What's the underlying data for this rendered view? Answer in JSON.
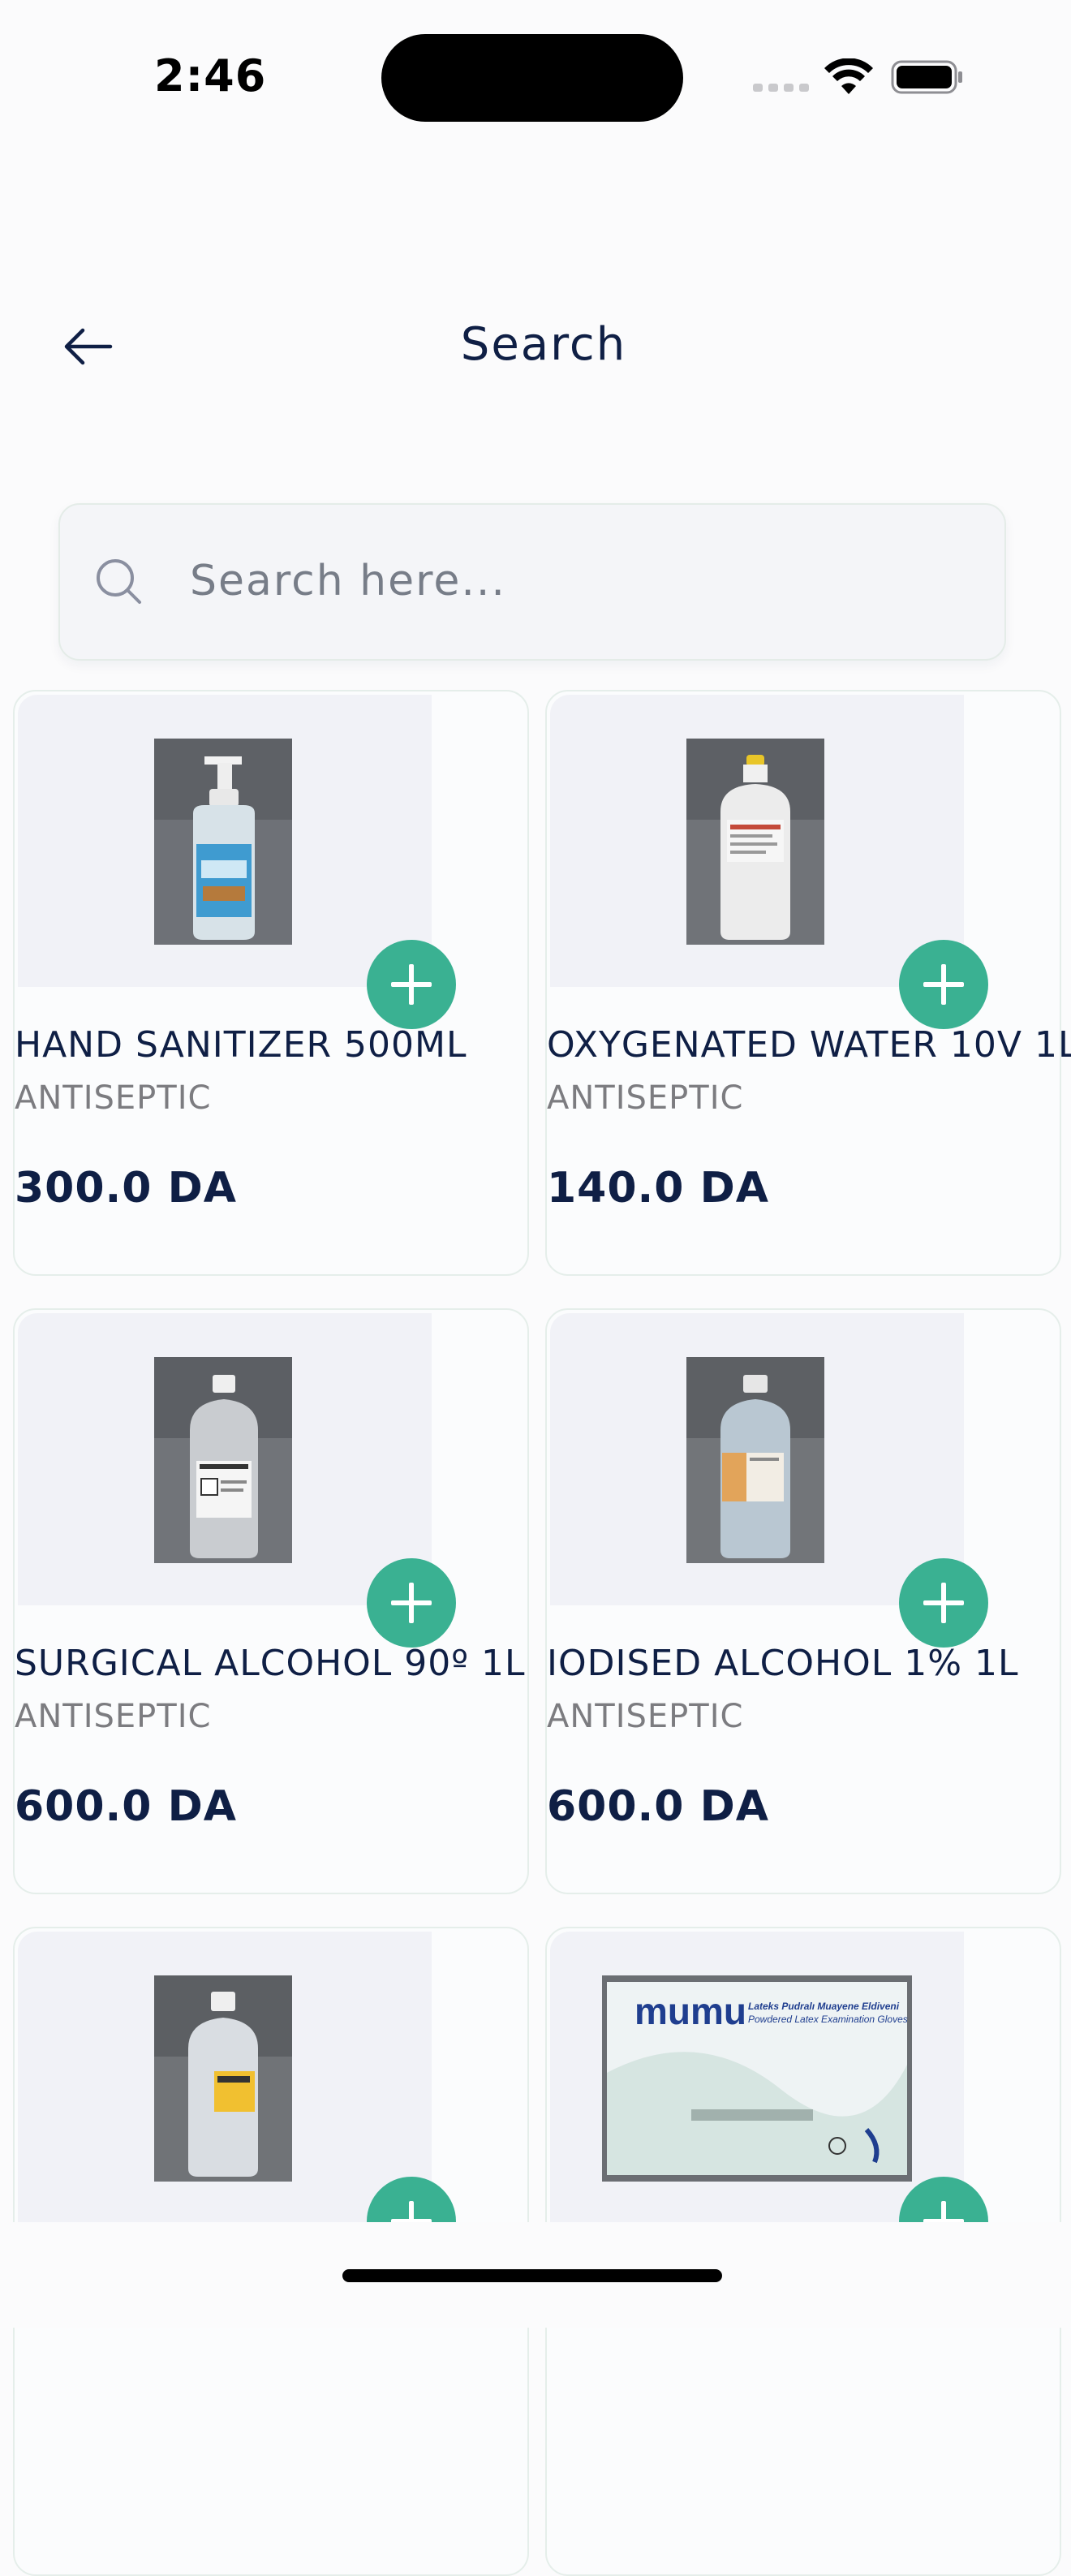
{
  "status_bar": {
    "time": "2:46"
  },
  "header": {
    "title": "Search"
  },
  "search": {
    "placeholder": "Search here..."
  },
  "products": [
    {
      "name": "HAND SANITIZER 500ML",
      "category": "ANTISEPTIC",
      "price": "300.0 DA"
    },
    {
      "name": "OXYGENATED WATER 10V 1L",
      "category": "ANTISEPTIC",
      "price": "140.0 DA"
    },
    {
      "name": "SURGICAL ALCOHOL 90º 1L",
      "category": "ANTISEPTIC",
      "price": "600.0 DA"
    },
    {
      "name": "IODISED ALCOHOL 1% 1L",
      "category": "ANTISEPTIC",
      "price": "600.0 DA"
    }
  ],
  "gloves_box": {
    "brand": "mumu",
    "line1": "Lateks Pudralı Muayene Eldiveni",
    "line2": "Powdered Latex Examination Gloves"
  },
  "colors": {
    "accent": "#3ab192",
    "text": "#0f1f45",
    "muted": "#7c7c80"
  }
}
